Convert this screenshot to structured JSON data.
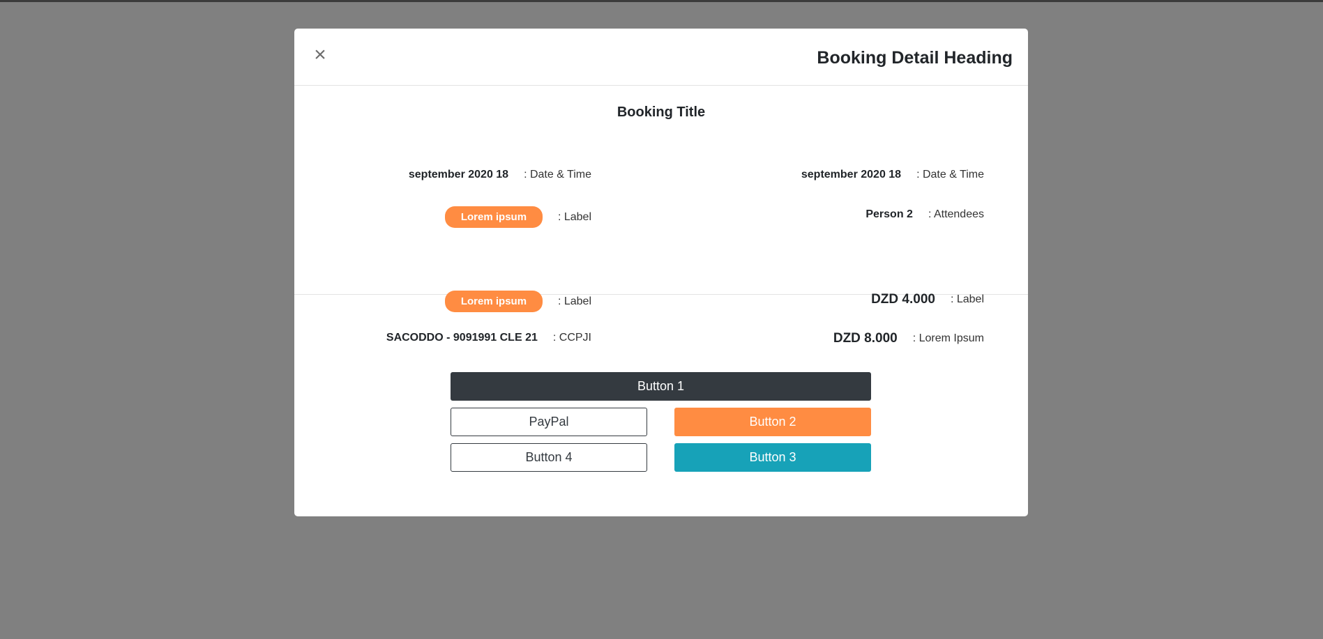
{
  "modal": {
    "close_symbol": "×",
    "heading": "Booking Detail Heading"
  },
  "details": {
    "title": "Booking Title",
    "rows": {
      "date_left_value": "september 2020 18",
      "date_left_label": ": Date & Time",
      "date_right_value": "september 2020 18",
      "date_right_label": ": Date & Time",
      "tag_left_value": "Lorem ipsum",
      "tag_left_label": ": Label",
      "attendees_value": "Person 2",
      "attendees_label": ": Attendees"
    }
  },
  "payment": {
    "tag_value": "Lorem ipsum",
    "tag_label": ": Label",
    "amount1_value": "DZD 4.000",
    "amount1_label": ": Label",
    "ccp_value": "SACODDO - 9091991 CLE 21",
    "ccp_label": ": CCPJI",
    "amount2_value": "DZD 8.000",
    "amount2_label": ": Lorem Ipsum"
  },
  "buttons": {
    "button1": "Button 1",
    "paypal": "PayPal",
    "button2": "Button 2",
    "button4": "Button 4",
    "button3": "Button 3"
  },
  "colors": {
    "backdrop": "#808080",
    "accent_orange": "#ff8c42",
    "teal": "#17a2b8",
    "dark": "#343a40"
  },
  "icons": {
    "close": "close-icon"
  }
}
